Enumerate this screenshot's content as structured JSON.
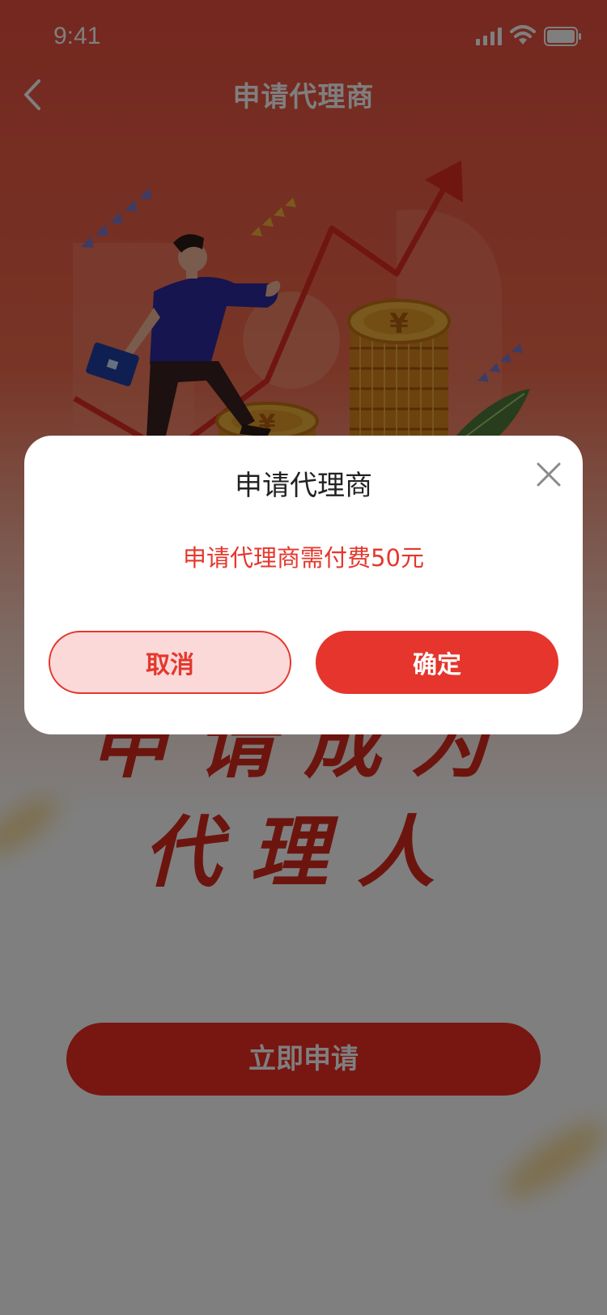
{
  "status_bar": {
    "time": "9:41"
  },
  "nav": {
    "title": "申请代理商"
  },
  "hero": {
    "currency_symbol": "¥"
  },
  "slogan": {
    "line1": "申请成为",
    "line2": "代理人"
  },
  "apply_button_label": "立即申请",
  "modal": {
    "title": "申请代理商",
    "message": "申请代理商需付费50元",
    "cancel_label": "取消",
    "confirm_label": "确定"
  },
  "colors": {
    "accent_red": "#e5352c",
    "cancel_bg": "#fbd9d9",
    "overlay": "rgba(0,0,0,0.5)"
  },
  "icons": [
    "back-icon",
    "signal-icon",
    "wifi-icon",
    "battery-icon",
    "close-icon"
  ]
}
